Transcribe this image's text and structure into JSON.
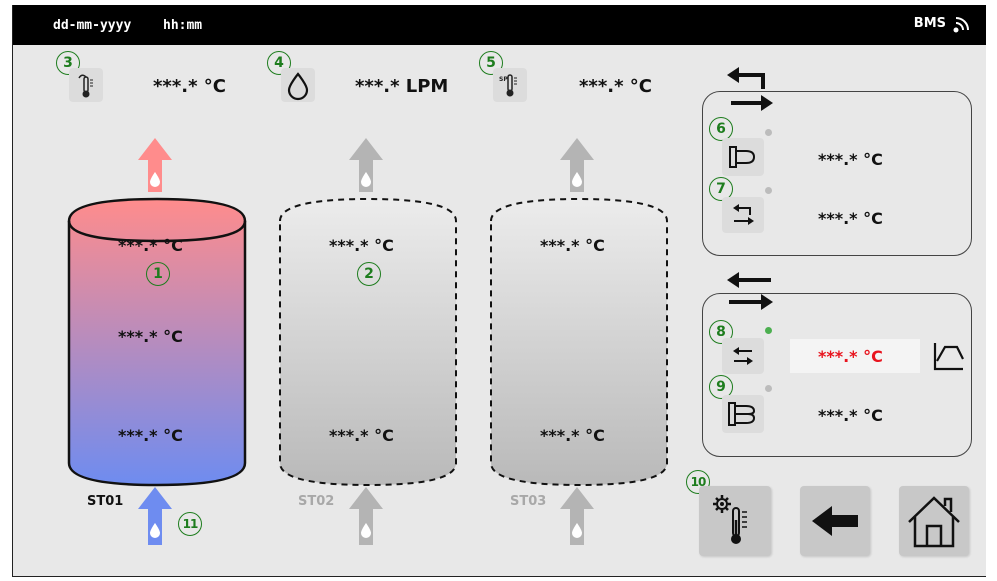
{
  "topbar": {
    "date": "dd-mm-yyyy",
    "time": "hh:mm",
    "bms": "BMS"
  },
  "sensors": {
    "return_temp": "***.* °C",
    "flow": "***.* LPM",
    "setpoint_temp": "***.* °C"
  },
  "tanks": [
    {
      "label": "ST01",
      "top": "***.* °C",
      "mid": "***.* °C",
      "bottom": "***.* °C",
      "active": true
    },
    {
      "label": "ST02",
      "top": "***.* °C",
      "bottom": "***.* °C",
      "active": false
    },
    {
      "label": "ST03",
      "top": "***.* °C",
      "bottom": "***.* °C",
      "active": false
    }
  ],
  "circuit1": {
    "row6": "***.* °C",
    "row7": "***.* °C"
  },
  "circuit2": {
    "row8": "***.* °C",
    "row9": "***.* °C"
  },
  "markers": [
    "1",
    "2",
    "3",
    "4",
    "5",
    "6",
    "7",
    "8",
    "9",
    "10",
    "11"
  ],
  "colors": {
    "hot": "#ff8c8c",
    "cold": "#6e8cf0",
    "alarm": "#e8141e",
    "marker": "#1e7d1e"
  }
}
